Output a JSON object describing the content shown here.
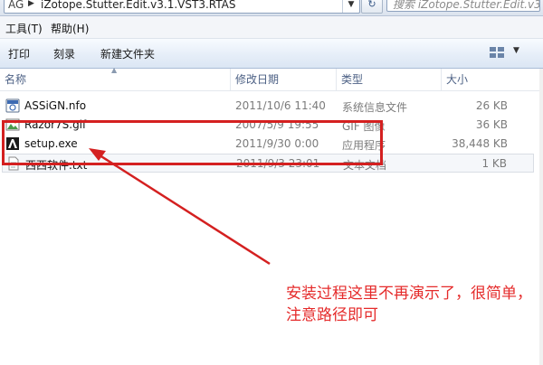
{
  "address_bar": {
    "segment_prefix": "AG",
    "path": "iZotope.Stutter.Edit.v3.1.VST3.RTAS",
    "search_placeholder": "搜索 iZotope.Stutter.Edit.v3..."
  },
  "menu": {
    "tools": "工具(T)",
    "help": "帮助(H)"
  },
  "toolbar": {
    "print": "打印",
    "burn": "刻录",
    "new_folder": "新建文件夹"
  },
  "columns": {
    "name": "名称",
    "date": "修改日期",
    "type": "类型",
    "size": "大小"
  },
  "files": [
    {
      "name": "ASSiGN.nfo",
      "date": "2011/10/6 11:40",
      "type": "系统信息文件",
      "size": "26 KB",
      "icon": "nfo-file-icon"
    },
    {
      "name": "Razor7S.gif",
      "date": "2007/5/9 19:55",
      "type": "GIF 图像",
      "size": "36 KB",
      "icon": "gif-image-icon"
    },
    {
      "name": "setup.exe",
      "date": "2011/9/30 0:00",
      "type": "应用程序",
      "size": "38,448 KB",
      "icon": "setup-exe-icon"
    },
    {
      "name": "西西软件.txt",
      "date": "2011/9/3 23:01",
      "type": "文本文档",
      "size": "1 KB",
      "icon": "text-file-icon"
    }
  ],
  "annotation": {
    "text": "安装过程这里不再演示了，很简单，注意路径即可",
    "color": "#e52b2b"
  },
  "colors": {
    "annotation_red": "#d42020",
    "column_header_text": "#4d6185",
    "secondary_text": "#7b7b7b"
  }
}
